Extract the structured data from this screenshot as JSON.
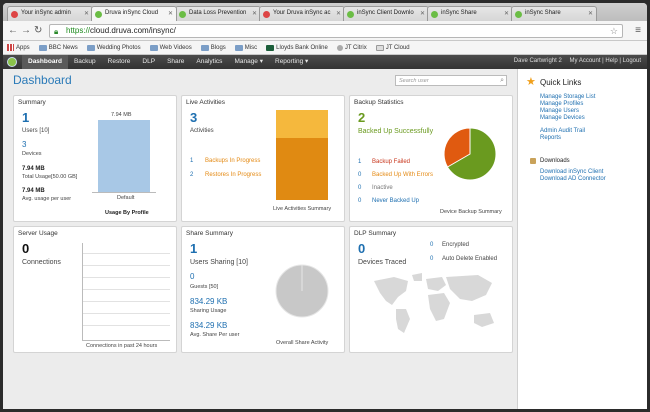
{
  "browser": {
    "tabs": [
      {
        "title": "Your inSync admin",
        "color": "#d44"
      },
      {
        "title": "Druva inSync Cloud",
        "color": "#6bbd45"
      },
      {
        "title": "Data Loss Prevention",
        "color": "#6bbd45"
      },
      {
        "title": "Your Druva inSync ac",
        "color": "#d44"
      },
      {
        "title": "inSync Client Downlo",
        "color": "#6bbd45"
      },
      {
        "title": "inSync Share",
        "color": "#6bbd45"
      },
      {
        "title": "inSync Share",
        "color": "#6bbd45"
      }
    ],
    "url_scheme": "https://",
    "url_rest": "cloud.druva.com/insync/",
    "bookmarks": [
      "Apps",
      "BBC News",
      "Wedding Photos",
      "Web Videos",
      "Blogs",
      "Misc",
      "Lloyds Bank Online",
      "JT Citrix",
      "JT Cloud"
    ]
  },
  "nav": {
    "items": [
      "Dashboard",
      "Backup",
      "Restore",
      "DLP",
      "Share",
      "Analytics",
      "Manage ▾",
      "Reporting ▾"
    ],
    "user": "Dave Cartwright 2",
    "account": "My Account | Help | Logout"
  },
  "page": {
    "title": "Dashboard",
    "search_placeholder": "Search user"
  },
  "summary": {
    "title": "Summary",
    "users": "1",
    "users_label": "Users [10]",
    "devices": "3",
    "devices_label": "Devices",
    "total_usage": "7.94 MB",
    "total_usage_label": "Total Usage[50.00 GB]",
    "avg_usage": "7.94 MB",
    "avg_usage_label": "Avg. usage per user",
    "bar_value_label": "7.94 MB",
    "bar_category": "Default",
    "chart_caption": "Usage By Profile"
  },
  "live": {
    "title": "Live Activities",
    "count": "3",
    "count_label": "Activities",
    "backups_count": "1",
    "backups_label": "Backups In Progress",
    "restores_count": "2",
    "restores_label": "Restores In Progress",
    "chart_caption": "Live Activities Summary"
  },
  "backup": {
    "title": "Backup Statistics",
    "count": "2",
    "count_label": "Backed Up Successfully",
    "failed_count": "1",
    "failed_label": "Backup Failed",
    "errors_count": "0",
    "errors_label": "Backed Up With Errors",
    "inactive_count": "0",
    "inactive_label": "Inactive",
    "never_count": "0",
    "never_label": "Never Backed Up",
    "chart_caption": "Device Backup Summary"
  },
  "server": {
    "title": "Server Usage",
    "count": "0",
    "count_label": "Connections",
    "chart_caption": "Connections in past 24 hours"
  },
  "share": {
    "title": "Share Summary",
    "users": "1",
    "users_label": "Users Sharing [10]",
    "guests": "0",
    "guests_label": "Guests [50]",
    "sharing_usage": "834.29 KB",
    "sharing_usage_label": "Sharing Usage",
    "avg_share": "834.29 KB",
    "avg_share_label": "Avg. Share Per user",
    "chart_caption": "Overall Share Activity"
  },
  "dlp": {
    "title": "DLP Summary",
    "count": "0",
    "count_label": "Devices Traced",
    "encrypted_count": "0",
    "encrypted_label": "Encrypted",
    "autodelete_count": "0",
    "autodelete_label": "Auto Delete Enabled"
  },
  "quicklinks": {
    "title": "Quick Links",
    "group1": [
      "Manage Storage List",
      "Manage Profiles",
      "Manage Users",
      "Manage Devices"
    ],
    "group2": [
      "Admin Audit Trail",
      "Reports"
    ],
    "downloads_title": "Downloads",
    "downloads": [
      "Download inSync Client",
      "Download AD Connector"
    ]
  },
  "colors": {
    "accent": "#1e6fb0",
    "bar_blue": "#a8c8e6",
    "live_orange_light": "#f5b83d",
    "live_orange_dark": "#e08a12",
    "pie_green": "#6a9a1f",
    "pie_orange": "#e05a10"
  }
}
